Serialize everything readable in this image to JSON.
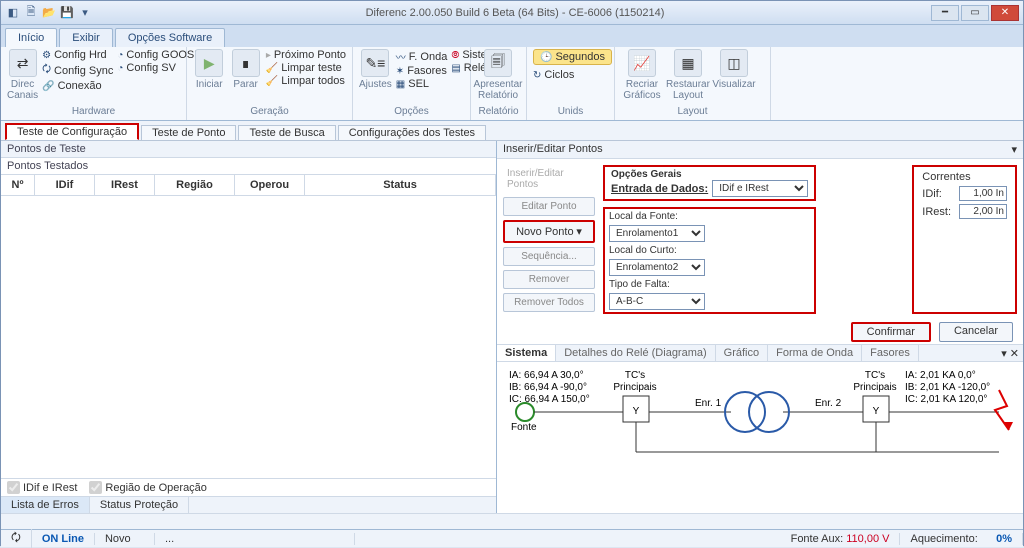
{
  "title": "Diferenc 2.00.050 Build 6 Beta (64 Bits) - CE-6006 (1150214)",
  "menuTabs": {
    "inicio": "Início",
    "exibir": "Exibir",
    "opcoes": "Opções Software"
  },
  "ribbon": {
    "hardware": {
      "label": "Hardware",
      "direc": "Direc\nCanais",
      "cfgHrd": "Config Hrd",
      "cfgGoose": "Config GOOSE",
      "cfgSync": "Config Sync",
      "cfgSV": "Config SV",
      "conexao": "Conexão"
    },
    "geracao": {
      "label": "Geração",
      "iniciar": "Iniciar",
      "parar": "Parar",
      "prox": "Próximo Ponto",
      "limpar": "Limpar teste",
      "limparTodos": "Limpar todos"
    },
    "opcoes": {
      "label": "Opções",
      "ajustes": "Ajustes",
      "fonda": "F. Onda",
      "fasores": "Fasores",
      "sel": "SEL",
      "sistema": "Sistema",
      "rele": "Relé"
    },
    "relatorio": {
      "label": "Relatório",
      "apresentar": "Apresentar\nRelatório"
    },
    "unids": {
      "label": "Unids",
      "segundos": "Segundos",
      "ciclos": "Ciclos"
    },
    "layout": {
      "label": "Layout",
      "recriar": "Recriar\nGráficos",
      "restaurar": "Restaurar\nLayout",
      "visualizar": "Visualizar"
    }
  },
  "subtabs": {
    "t1": "Teste de Configuração",
    "t2": "Teste de Ponto",
    "t3": "Teste de Busca",
    "t4": "Configurações dos Testes"
  },
  "left": {
    "title1": "Pontos de Teste",
    "title2": "Pontos Testados",
    "cols": {
      "n": "Nº",
      "idif": "IDif",
      "irest": "IRest",
      "reg": "Região",
      "op": "Operou",
      "stat": "Status"
    },
    "chk1": "IDif e IRest",
    "chk2": "Região de Operação",
    "lt1": "Lista de Erros",
    "lt2": "Status Proteção"
  },
  "right": {
    "sec": "Inserir/Editar Pontos",
    "btns": {
      "hdr": "Inserir/Editar Pontos",
      "editar": "Editar Ponto",
      "novo": "Novo Ponto",
      "seq": "Sequência...",
      "rem": "Remover",
      "remT": "Remover Todos"
    },
    "opt": {
      "hdr": "Opções Gerais",
      "entrada": "Entrada de Dados:",
      "entradaVal": "IDif e IRest"
    },
    "loc": {
      "fonte": "Local da Fonte:",
      "fonteVal": "Enrolamento1",
      "curto": "Local do Curto:",
      "curtoVal": "Enrolamento2",
      "falta": "Tipo de Falta:",
      "faltaVal": "A-B-C"
    },
    "corr": {
      "hdr": "Correntes",
      "idif": "IDif:",
      "idifV": "1,00 In",
      "irest": "IRest:",
      "irestV": "2,00 In"
    },
    "confirm": "Confirmar",
    "cancel": "Cancelar",
    "dtabs": {
      "sistema": "Sistema",
      "det": "Detalhes do Relé (Diagrama)",
      "graf": "Gráfico",
      "onda": "Forma de Onda",
      "fas": "Fasores"
    },
    "diag": {
      "ia1": "IA: 66,94 A 30,0°",
      "ib1": "IB: 66,94 A -90,0°",
      "ic1": "IC: 66,94 A 150,0°",
      "ia2": "IA: 2,01 KA 0,0°",
      "ib2": "IB: 2,01 KA -120,0°",
      "ic2": "IC: 2,01 KA 120,0°",
      "fonte": "Fonte",
      "tc": "TC's\nPrincipais",
      "enr1": "Enr. 1",
      "enr2": "Enr. 2"
    }
  },
  "status": {
    "online": "ON Line",
    "novo": "Novo",
    "dots": "...",
    "fonte": "Fonte Aux:",
    "fonteV": "110,00 V",
    "aquec": "Aquecimento:",
    "aquecV": "0%"
  }
}
